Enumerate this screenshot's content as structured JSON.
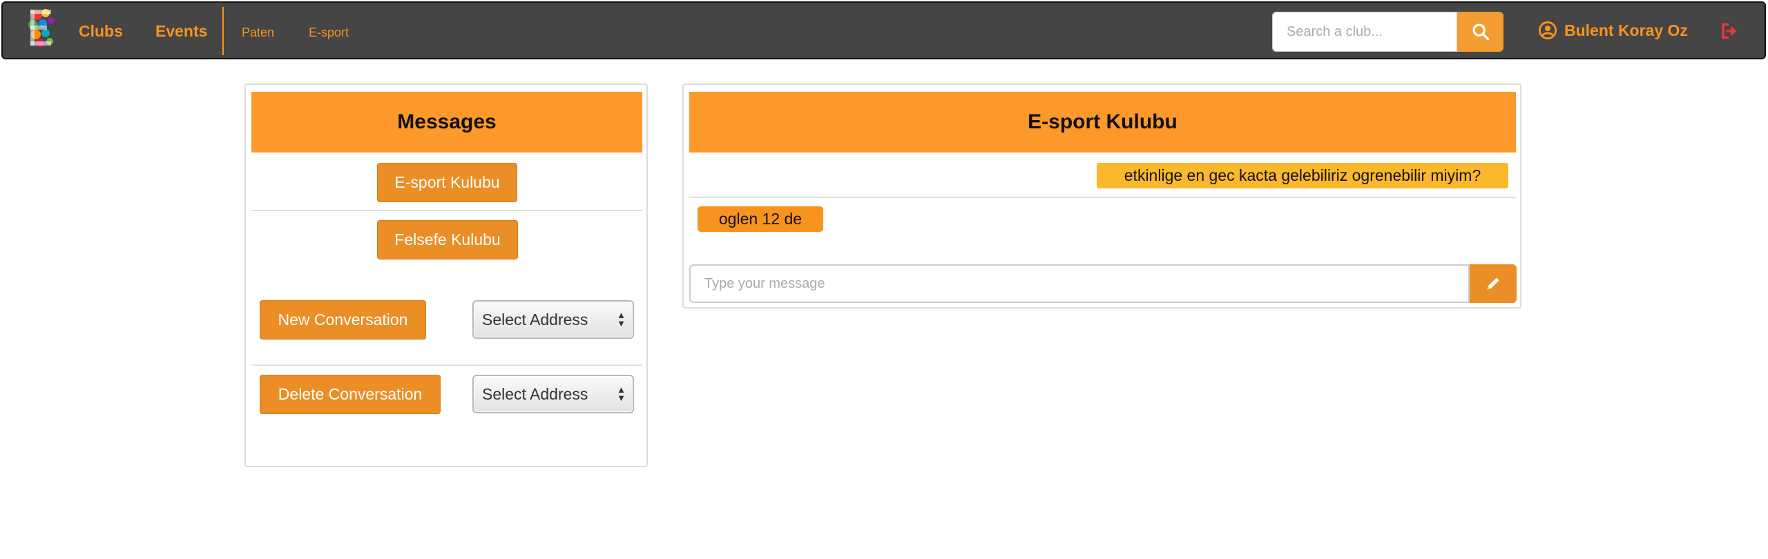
{
  "nav": {
    "clubs": "Clubs",
    "events": "Events",
    "sub_links": [
      "Paten",
      "E-sport"
    ],
    "search_placeholder": "Search a club...",
    "user_name": "Bulent Koray Oz"
  },
  "messages_panel": {
    "title": "Messages",
    "conversations": [
      "E-sport Kulubu",
      "Felsefe Kulubu"
    ],
    "new_conversation": "New Conversation",
    "delete_conversation": "Delete Conversation",
    "select_address": "Select Address"
  },
  "chat": {
    "title": "E-sport Kulubu",
    "messages": [
      {
        "direction": "sent",
        "text": "etkinlige en gec kacta gelebiliriz ogrenebilir miyim?"
      },
      {
        "direction": "received",
        "text": "oglen 12 de"
      }
    ],
    "input_placeholder": "Type your message"
  },
  "colors": {
    "navbar": "#454545",
    "accent": "#f7931e",
    "header": "#fd982a",
    "sent_bubble": "#fbb82c",
    "logout": "#e53935"
  },
  "icons": {
    "logo": "club-logo",
    "search": "search-icon",
    "user": "user-circle-icon",
    "logout": "logout-icon",
    "send": "pencil-icon"
  }
}
